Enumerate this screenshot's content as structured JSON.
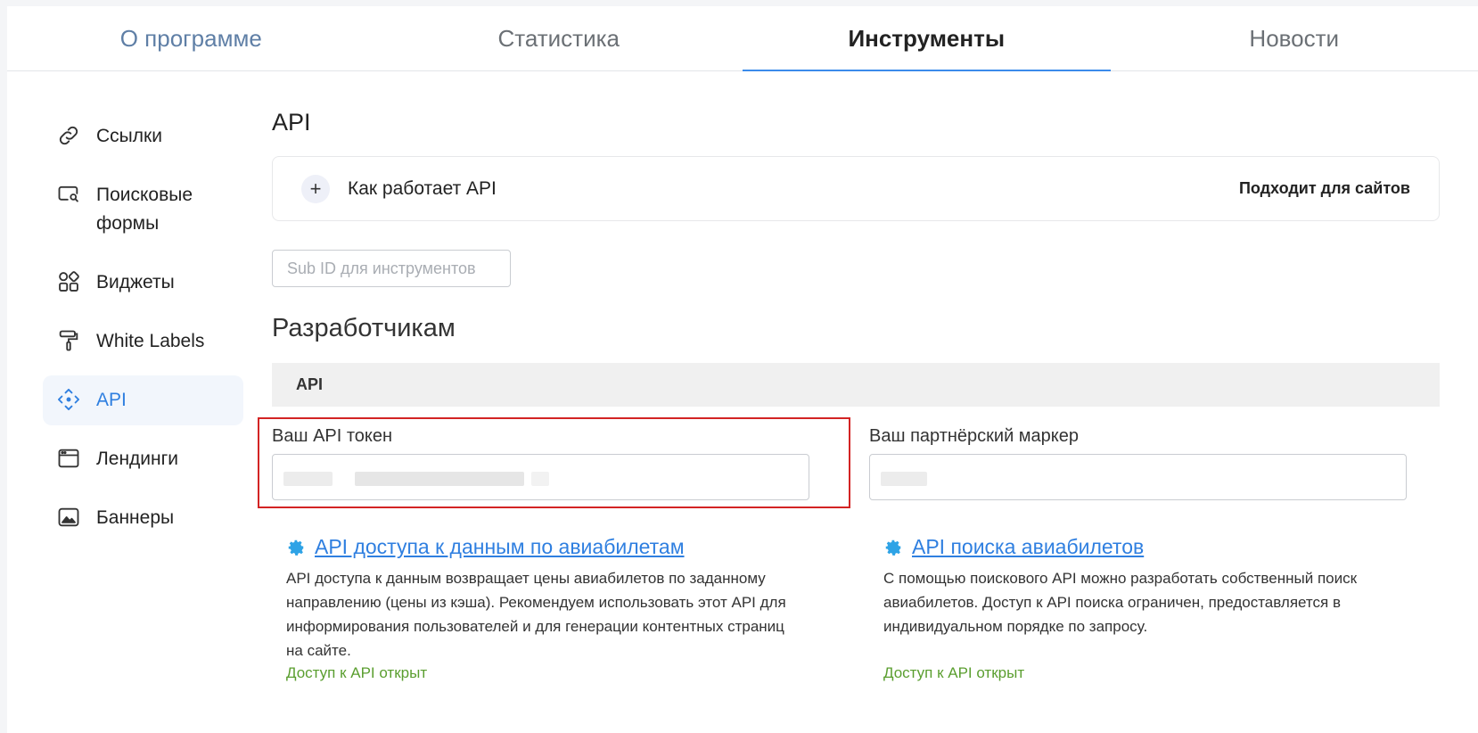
{
  "tabs": [
    {
      "label": "О программе"
    },
    {
      "label": "Статистика"
    },
    {
      "label": "Инструменты"
    },
    {
      "label": "Новости"
    }
  ],
  "sidebar": {
    "items": [
      {
        "label": "Ссылки",
        "icon": "link-icon"
      },
      {
        "label": "Поисковые формы",
        "icon": "search-form-icon"
      },
      {
        "label": "Виджеты",
        "icon": "widgets-icon"
      },
      {
        "label": "White Labels",
        "icon": "paint-roller-icon"
      },
      {
        "label": "API",
        "icon": "api-icon"
      },
      {
        "label": "Лендинги",
        "icon": "browser-window-icon"
      },
      {
        "label": "Баннеры",
        "icon": "image-icon"
      }
    ]
  },
  "main": {
    "title": "API",
    "accordion": {
      "title": "Как работает API",
      "badge": "Подходит для сайтов"
    },
    "subid_placeholder": "Sub ID для инструментов",
    "dev_title": "Разработчикам",
    "api_bar": "API",
    "token_label": "Ваш API токен",
    "marker_label": "Ваш партнёрский маркер",
    "apis": [
      {
        "title": "API доступа к данным по авиабилетам",
        "description": "API доступа к данным возвращает цены авиабилетов по заданному направлению (цены из кэша). Рекомендуем использовать этот API для информирования пользователей и для генерации контентных страниц на сайте.",
        "status": "Доступ к API открыт"
      },
      {
        "title": "API поиска авиабилетов",
        "description": "С помощью поискового API можно разработать собственный поиск авиабилетов. Доступ к API поиска ограничен, предоставляется в индивидуальном порядке по запросу.",
        "status": "Доступ к API открыт"
      }
    ]
  },
  "colors": {
    "accent": "#2f7fe0",
    "success": "#5a9e2f",
    "highlight": "#d32424"
  }
}
